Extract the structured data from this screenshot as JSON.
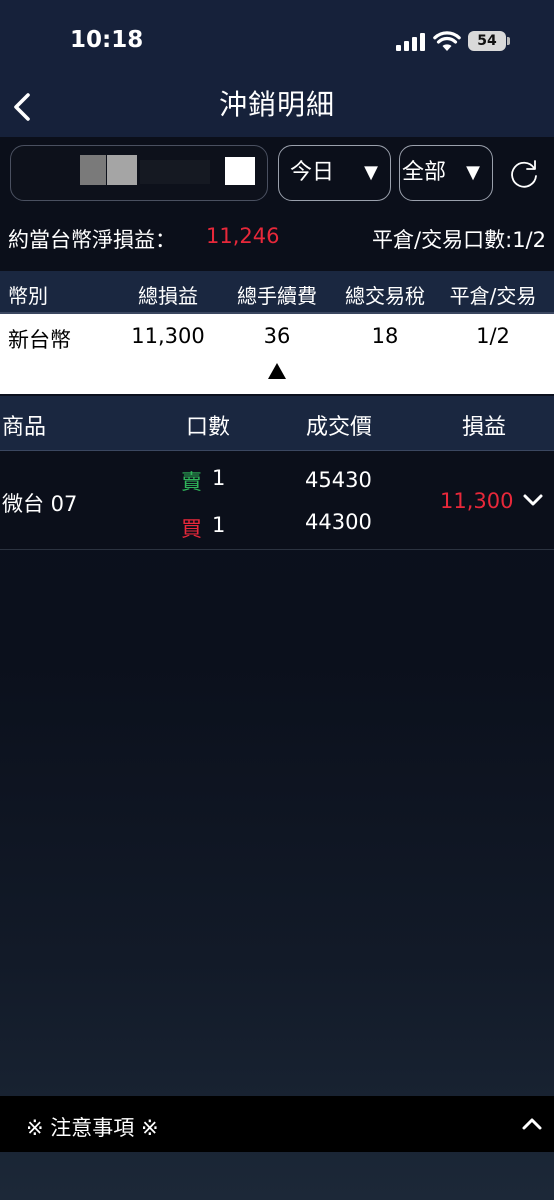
{
  "status_bar": {
    "time": "10:18",
    "battery": "54"
  },
  "nav": {
    "title": "沖銷明細"
  },
  "filters": {
    "date": "今日",
    "type": "全部",
    "arrow": "▼"
  },
  "summary": {
    "net_label": "約當台幣淨損益：",
    "net_value": "11,246",
    "close_trade_label": "平倉/交易口數:1/2"
  },
  "currency_table": {
    "headers": [
      "幣別",
      "總損益",
      "總手續費",
      "總交易稅",
      "平倉/交易"
    ],
    "rows": [
      {
        "currency": "新台幣",
        "total_pl": "11,300",
        "fee": "36",
        "tax": "18",
        "close_trade": "1/2"
      }
    ]
  },
  "detail_table": {
    "headers": [
      "商品",
      "口數",
      "成交價",
      "損益"
    ],
    "rows": [
      {
        "product": "微台 07",
        "sell_label": "賣",
        "sell_qty": "1",
        "buy_label": "買",
        "buy_qty": "1",
        "sell_price": "45430",
        "buy_price": "44300",
        "pl": "11,300"
      }
    ]
  },
  "notice": {
    "label": "※ 注意事項 ※"
  },
  "colors": {
    "profit": "#e8283a",
    "sell": "#2fb55a",
    "header_bg": "#1a2740"
  }
}
